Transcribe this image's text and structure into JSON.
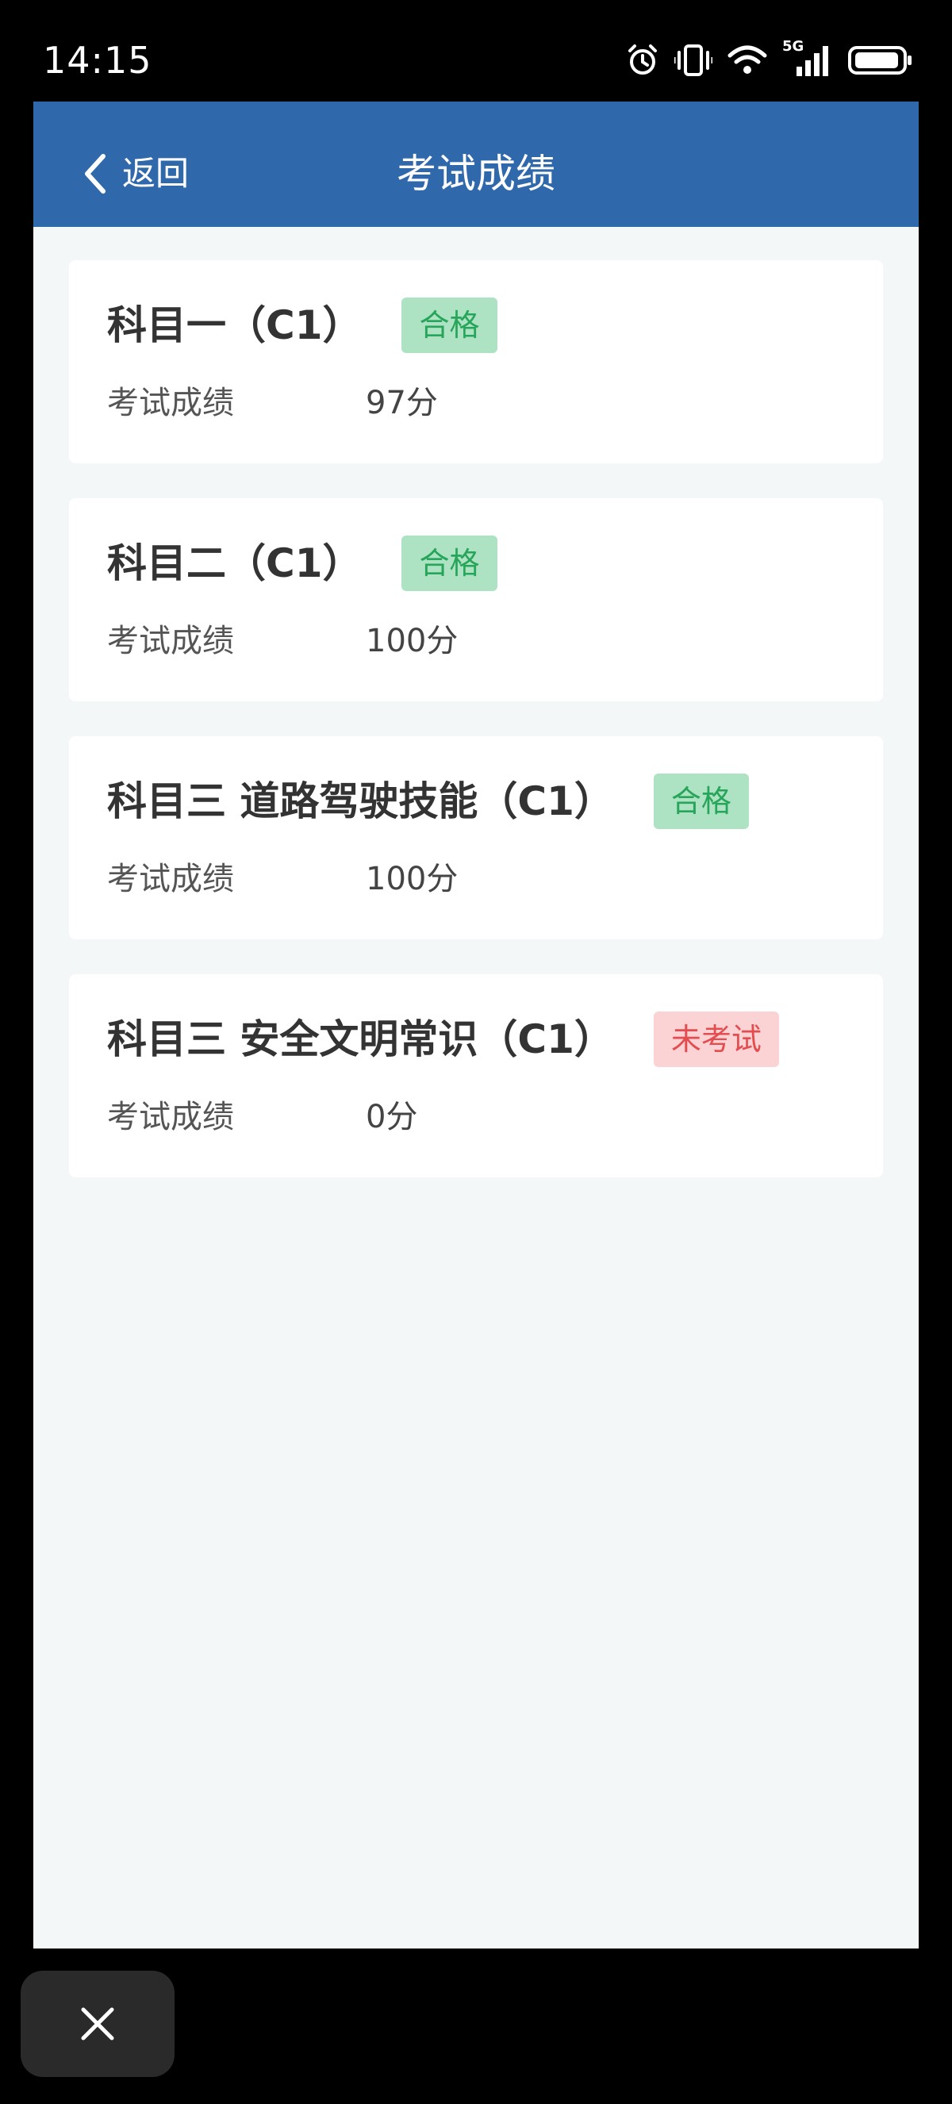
{
  "status_bar": {
    "time": "14:15",
    "network": "5G",
    "icons": [
      "alarm-icon",
      "vibrate-icon",
      "wifi-icon",
      "signal-icon",
      "battery-icon"
    ]
  },
  "navbar": {
    "back_label": "返回",
    "title": "考试成绩",
    "background": "#2f68ab"
  },
  "results": [
    {
      "subject": "科目一（C1）",
      "status": "合格",
      "status_type": "pass",
      "score_label": "考试成绩",
      "score": "97分"
    },
    {
      "subject": "科目二（C1）",
      "status": "合格",
      "status_type": "pass",
      "score_label": "考试成绩",
      "score": "100分"
    },
    {
      "subject": "科目三 道路驾驶技能（C1）",
      "status": "合格",
      "status_type": "pass",
      "score_label": "考试成绩",
      "score": "100分"
    },
    {
      "subject": "科目三 安全文明常识（C1）",
      "status": "未考试",
      "status_type": "notyet",
      "score_label": "考试成绩",
      "score": "0分"
    }
  ],
  "colors": {
    "pass_badge_bg": "#ade3c2",
    "pass_badge_text": "#27a55a",
    "notyet_badge_bg": "#fbd3d4",
    "notyet_badge_text": "#e34d4f",
    "page_bg": "#f4f7f8"
  },
  "floating": {
    "close_icon": "close-icon"
  }
}
